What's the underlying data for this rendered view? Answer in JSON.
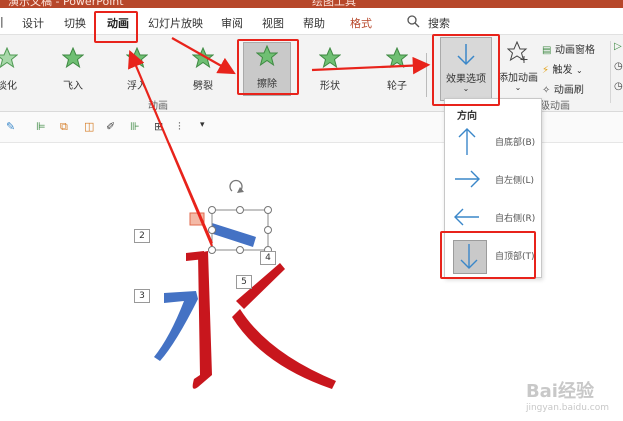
{
  "title_bar": {
    "left_text": "演示文稿 - PowerPoint",
    "center_text": "绘图工具"
  },
  "tabs": [
    {
      "label": "设计"
    },
    {
      "label": "切换"
    },
    {
      "label": "动画",
      "active": true
    },
    {
      "label": "幻灯片放映"
    },
    {
      "label": "审阅"
    },
    {
      "label": "视图"
    },
    {
      "label": "帮助"
    },
    {
      "label": "格式"
    }
  ],
  "search": {
    "label": "搜索"
  },
  "ribbon": {
    "effects": [
      {
        "label": "淡化"
      },
      {
        "label": "飞入"
      },
      {
        "label": "浮入"
      },
      {
        "label": "劈裂"
      },
      {
        "label": "擦除",
        "selected": true
      },
      {
        "label": "形状"
      },
      {
        "label": "轮子"
      }
    ],
    "effect_options_label": "效果选项",
    "add_animation_label": "添加动画",
    "animation_pane_label": "动画窗格",
    "trigger_label": "触发",
    "animation_painter_label": "动画刷",
    "group_animation_label": "动画",
    "group_advanced_label": "级动画"
  },
  "dropdown": {
    "title": "方向",
    "items": [
      {
        "label": "自底部(B)",
        "icon": "arrow-up-icon"
      },
      {
        "label": "自左侧(L)",
        "icon": "arrow-right-icon"
      },
      {
        "label": "自右侧(R)",
        "icon": "arrow-left-icon"
      },
      {
        "label": "自顶部(T)",
        "icon": "arrow-down-icon",
        "selected": true
      }
    ]
  },
  "slide": {
    "character": "永",
    "number_tags": [
      "2",
      "3",
      "4",
      "5"
    ]
  },
  "watermark": {
    "brand": "Bai经验",
    "url": "jingyan.baidu.com"
  },
  "colors": {
    "accent": "#b7472a",
    "stroke_red": "#c8161d",
    "stroke_blue": "#4472c4",
    "annotation": "#e8231b",
    "icon_green": "#6fbf73"
  }
}
